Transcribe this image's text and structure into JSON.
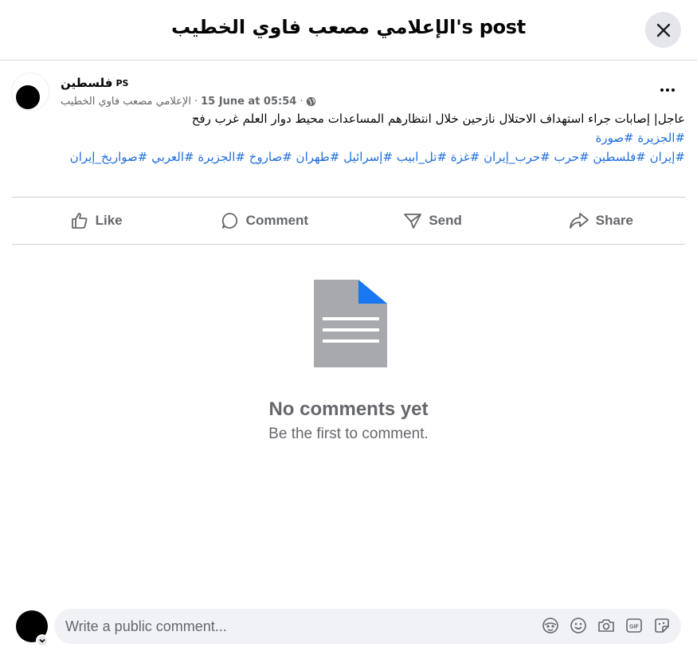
{
  "header": {
    "title": "الإعلامي مصعب فاوي الخطيب's post"
  },
  "post": {
    "author_name": "فلسطين",
    "author_badge": "PS",
    "byline": "الإعلامي مصعب فاوي الخطيب",
    "timestamp": "15 June at 05:54",
    "separator": "·",
    "text_line": "عاجل| إصابات جراء استهداف الاحتلال نازحين خلال انتظارهم المساعدات محيط دوار العلم غرب رفح",
    "hashtags_line1": [
      "#الجزيرة",
      "#صورة"
    ],
    "hashtags_line2": [
      "#إيران",
      "#فلسطين",
      "#حرب",
      "#حرب_إيران",
      "#غزة",
      "#تل_ابيب",
      "#إسرائيل",
      "#طهران",
      "#صاروخ",
      "#الجزيرة",
      "#العربي",
      "#صواريخ_إيران"
    ]
  },
  "actions": {
    "like": "Like",
    "comment": "Comment",
    "send": "Send",
    "share": "Share"
  },
  "empty_state": {
    "title": "No comments yet",
    "subtitle": "Be the first to comment."
  },
  "composer": {
    "placeholder": "Write a public comment..."
  },
  "colors": {
    "hashtag": "#216fdb",
    "muted": "#65676b",
    "divider": "#ced0d4",
    "input_bg": "#f0f2f5"
  }
}
